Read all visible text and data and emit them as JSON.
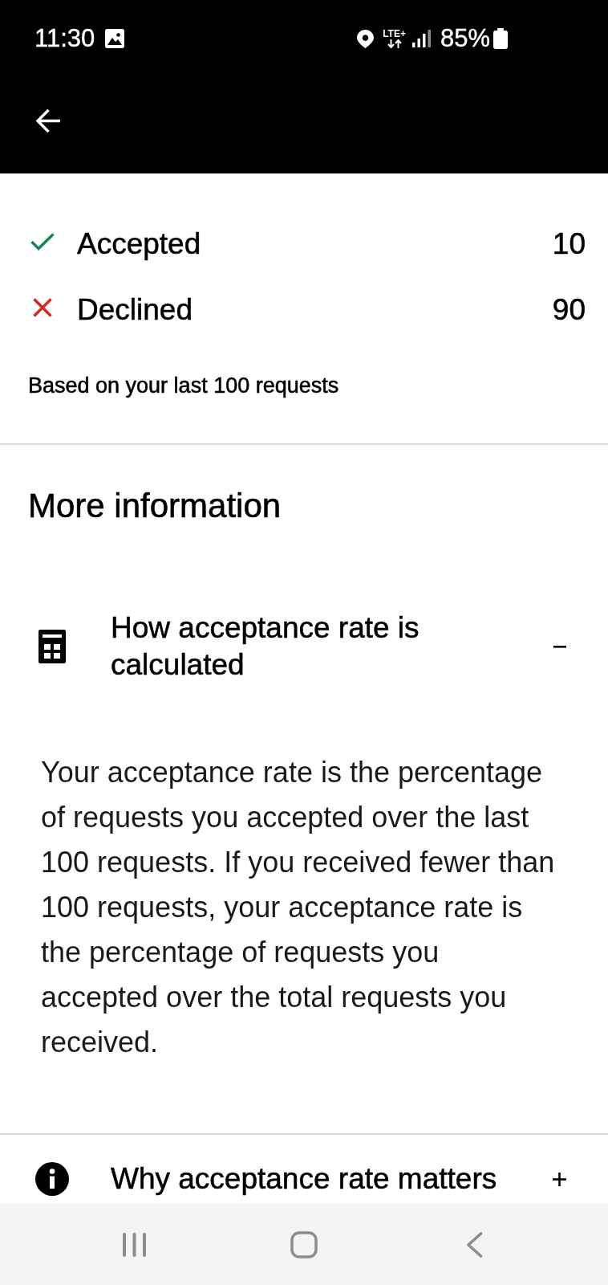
{
  "status_bar": {
    "time": "11:30",
    "network": "LTE+",
    "battery": "85%"
  },
  "summary": {
    "rows": [
      {
        "kind": "accepted",
        "label": "Accepted",
        "value": "10"
      },
      {
        "kind": "declined",
        "label": "Declined",
        "value": "90"
      }
    ],
    "note": "Based on your last 100 requests"
  },
  "more_information": {
    "title": "More information",
    "sections": [
      {
        "kind": "calculator",
        "title": "How acceptance rate is calculated",
        "expanded": true,
        "body": "Your acceptance rate is the percentage of requests you accepted over the last 100 requests. If you received fewer than 100 requests, your acceptance rate is the percentage of requests you accepted over the total requests you received."
      },
      {
        "kind": "info",
        "title": "Why acceptance rate matters",
        "expanded": false
      }
    ]
  }
}
